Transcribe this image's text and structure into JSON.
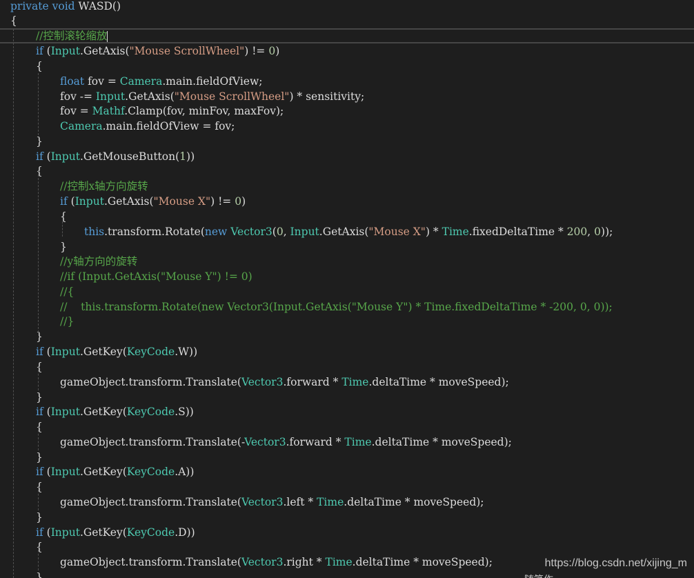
{
  "editor": {
    "language": "C#",
    "lines": [
      [
        [
          "kw",
          "private"
        ],
        [
          "tx",
          " "
        ],
        [
          "kw",
          "void"
        ],
        [
          "tx",
          " WASD()"
        ]
      ],
      [
        [
          "tx",
          "{"
        ]
      ],
      [
        [
          "cm",
          "//控制滚轮缩放"
        ]
      ],
      [
        [
          "kw",
          "if"
        ],
        [
          "tx",
          " ("
        ],
        [
          "ty",
          "Input"
        ],
        [
          "tx",
          ".GetAxis("
        ],
        [
          "str",
          "\"Mouse ScrollWheel\""
        ],
        [
          "tx",
          ") != "
        ],
        [
          "num",
          "0"
        ],
        [
          "tx",
          ")"
        ]
      ],
      [
        [
          "tx",
          "{"
        ]
      ],
      [
        [
          "kw",
          "float"
        ],
        [
          "tx",
          " fov = "
        ],
        [
          "ty",
          "Camera"
        ],
        [
          "tx",
          ".main.fieldOfView;"
        ]
      ],
      [
        [
          "tx",
          "fov -= "
        ],
        [
          "ty",
          "Input"
        ],
        [
          "tx",
          ".GetAxis("
        ],
        [
          "str",
          "\"Mouse ScrollWheel\""
        ],
        [
          "tx",
          ") * sensitivity;"
        ]
      ],
      [
        [
          "tx",
          "fov = "
        ],
        [
          "ty",
          "Mathf"
        ],
        [
          "tx",
          ".Clamp(fov, minFov, maxFov);"
        ]
      ],
      [
        [
          "ty",
          "Camera"
        ],
        [
          "tx",
          ".main.fieldOfView = fov;"
        ]
      ],
      [
        [
          "tx",
          "}"
        ]
      ],
      [
        [
          "kw",
          "if"
        ],
        [
          "tx",
          " ("
        ],
        [
          "ty",
          "Input"
        ],
        [
          "tx",
          ".GetMouseButton("
        ],
        [
          "num",
          "1"
        ],
        [
          "tx",
          "))"
        ]
      ],
      [
        [
          "tx",
          "{"
        ]
      ],
      [
        [
          "cm",
          "//控制x轴方向旋转"
        ]
      ],
      [
        [
          "kw",
          "if"
        ],
        [
          "tx",
          " ("
        ],
        [
          "ty",
          "Input"
        ],
        [
          "tx",
          ".GetAxis("
        ],
        [
          "str",
          "\"Mouse X\""
        ],
        [
          "tx",
          ") != "
        ],
        [
          "num",
          "0"
        ],
        [
          "tx",
          ")"
        ]
      ],
      [
        [
          "tx",
          "{"
        ]
      ],
      [
        [
          "kw",
          "this"
        ],
        [
          "tx",
          ".transform.Rotate("
        ],
        [
          "kw",
          "new"
        ],
        [
          "tx",
          " "
        ],
        [
          "ty",
          "Vector3"
        ],
        [
          "tx",
          "("
        ],
        [
          "num",
          "0"
        ],
        [
          "tx",
          ", "
        ],
        [
          "ty",
          "Input"
        ],
        [
          "tx",
          ".GetAxis("
        ],
        [
          "str",
          "\"Mouse X\""
        ],
        [
          "tx",
          ") * "
        ],
        [
          "ty",
          "Time"
        ],
        [
          "tx",
          ".fixedDeltaTime * "
        ],
        [
          "num",
          "200"
        ],
        [
          "tx",
          ", "
        ],
        [
          "num",
          "0"
        ],
        [
          "tx",
          "));"
        ]
      ],
      [
        [
          "tx",
          "}"
        ]
      ],
      [
        [
          "cm",
          "//y轴方向的旋转"
        ]
      ],
      [
        [
          "cm",
          "//if (Input.GetAxis(\"Mouse Y\") != 0)"
        ]
      ],
      [
        [
          "cm",
          "//{"
        ]
      ],
      [
        [
          "cm",
          "//    this.transform.Rotate(new Vector3(Input.GetAxis(\"Mouse Y\") * Time.fixedDeltaTime * -200, 0, 0));"
        ]
      ],
      [
        [
          "cm",
          "//}"
        ]
      ],
      [
        [
          "tx",
          "}"
        ]
      ],
      [
        [
          "kw",
          "if"
        ],
        [
          "tx",
          " ("
        ],
        [
          "ty",
          "Input"
        ],
        [
          "tx",
          ".GetKey("
        ],
        [
          "ty",
          "KeyCode"
        ],
        [
          "tx",
          ".W))"
        ]
      ],
      [
        [
          "tx",
          "{"
        ]
      ],
      [
        [
          "tx",
          "gameObject.transform.Translate("
        ],
        [
          "ty",
          "Vector3"
        ],
        [
          "tx",
          ".forward * "
        ],
        [
          "ty",
          "Time"
        ],
        [
          "tx",
          ".deltaTime * moveSpeed);"
        ]
      ],
      [
        [
          "tx",
          "}"
        ]
      ],
      [
        [
          "kw",
          "if"
        ],
        [
          "tx",
          " ("
        ],
        [
          "ty",
          "Input"
        ],
        [
          "tx",
          ".GetKey("
        ],
        [
          "ty",
          "KeyCode"
        ],
        [
          "tx",
          ".S))"
        ]
      ],
      [
        [
          "tx",
          "{"
        ]
      ],
      [
        [
          "tx",
          "gameObject.transform.Translate(-"
        ],
        [
          "ty",
          "Vector3"
        ],
        [
          "tx",
          ".forward * "
        ],
        [
          "ty",
          "Time"
        ],
        [
          "tx",
          ".deltaTime * moveSpeed);"
        ]
      ],
      [
        [
          "tx",
          "}"
        ]
      ],
      [
        [
          "kw",
          "if"
        ],
        [
          "tx",
          " ("
        ],
        [
          "ty",
          "Input"
        ],
        [
          "tx",
          ".GetKey("
        ],
        [
          "ty",
          "KeyCode"
        ],
        [
          "tx",
          ".A))"
        ]
      ],
      [
        [
          "tx",
          "{"
        ]
      ],
      [
        [
          "tx",
          "gameObject.transform.Translate("
        ],
        [
          "ty",
          "Vector3"
        ],
        [
          "tx",
          ".left * "
        ],
        [
          "ty",
          "Time"
        ],
        [
          "tx",
          ".deltaTime * moveSpeed);"
        ]
      ],
      [
        [
          "tx",
          "}"
        ]
      ],
      [
        [
          "kw",
          "if"
        ],
        [
          "tx",
          " ("
        ],
        [
          "ty",
          "Input"
        ],
        [
          "tx",
          ".GetKey("
        ],
        [
          "ty",
          "KeyCode"
        ],
        [
          "tx",
          ".D))"
        ]
      ],
      [
        [
          "tx",
          "{"
        ]
      ],
      [
        [
          "tx",
          "gameObject.transform.Translate("
        ],
        [
          "ty",
          "Vector3"
        ],
        [
          "tx",
          ".right * "
        ],
        [
          "ty",
          "Time"
        ],
        [
          "tx",
          ".deltaTime * moveSpeed);"
        ]
      ],
      [
        [
          "tx",
          "}"
        ]
      ]
    ]
  },
  "watermark": "https://blog.csdn.net/xijing_m",
  "cut_text": "随笔作"
}
